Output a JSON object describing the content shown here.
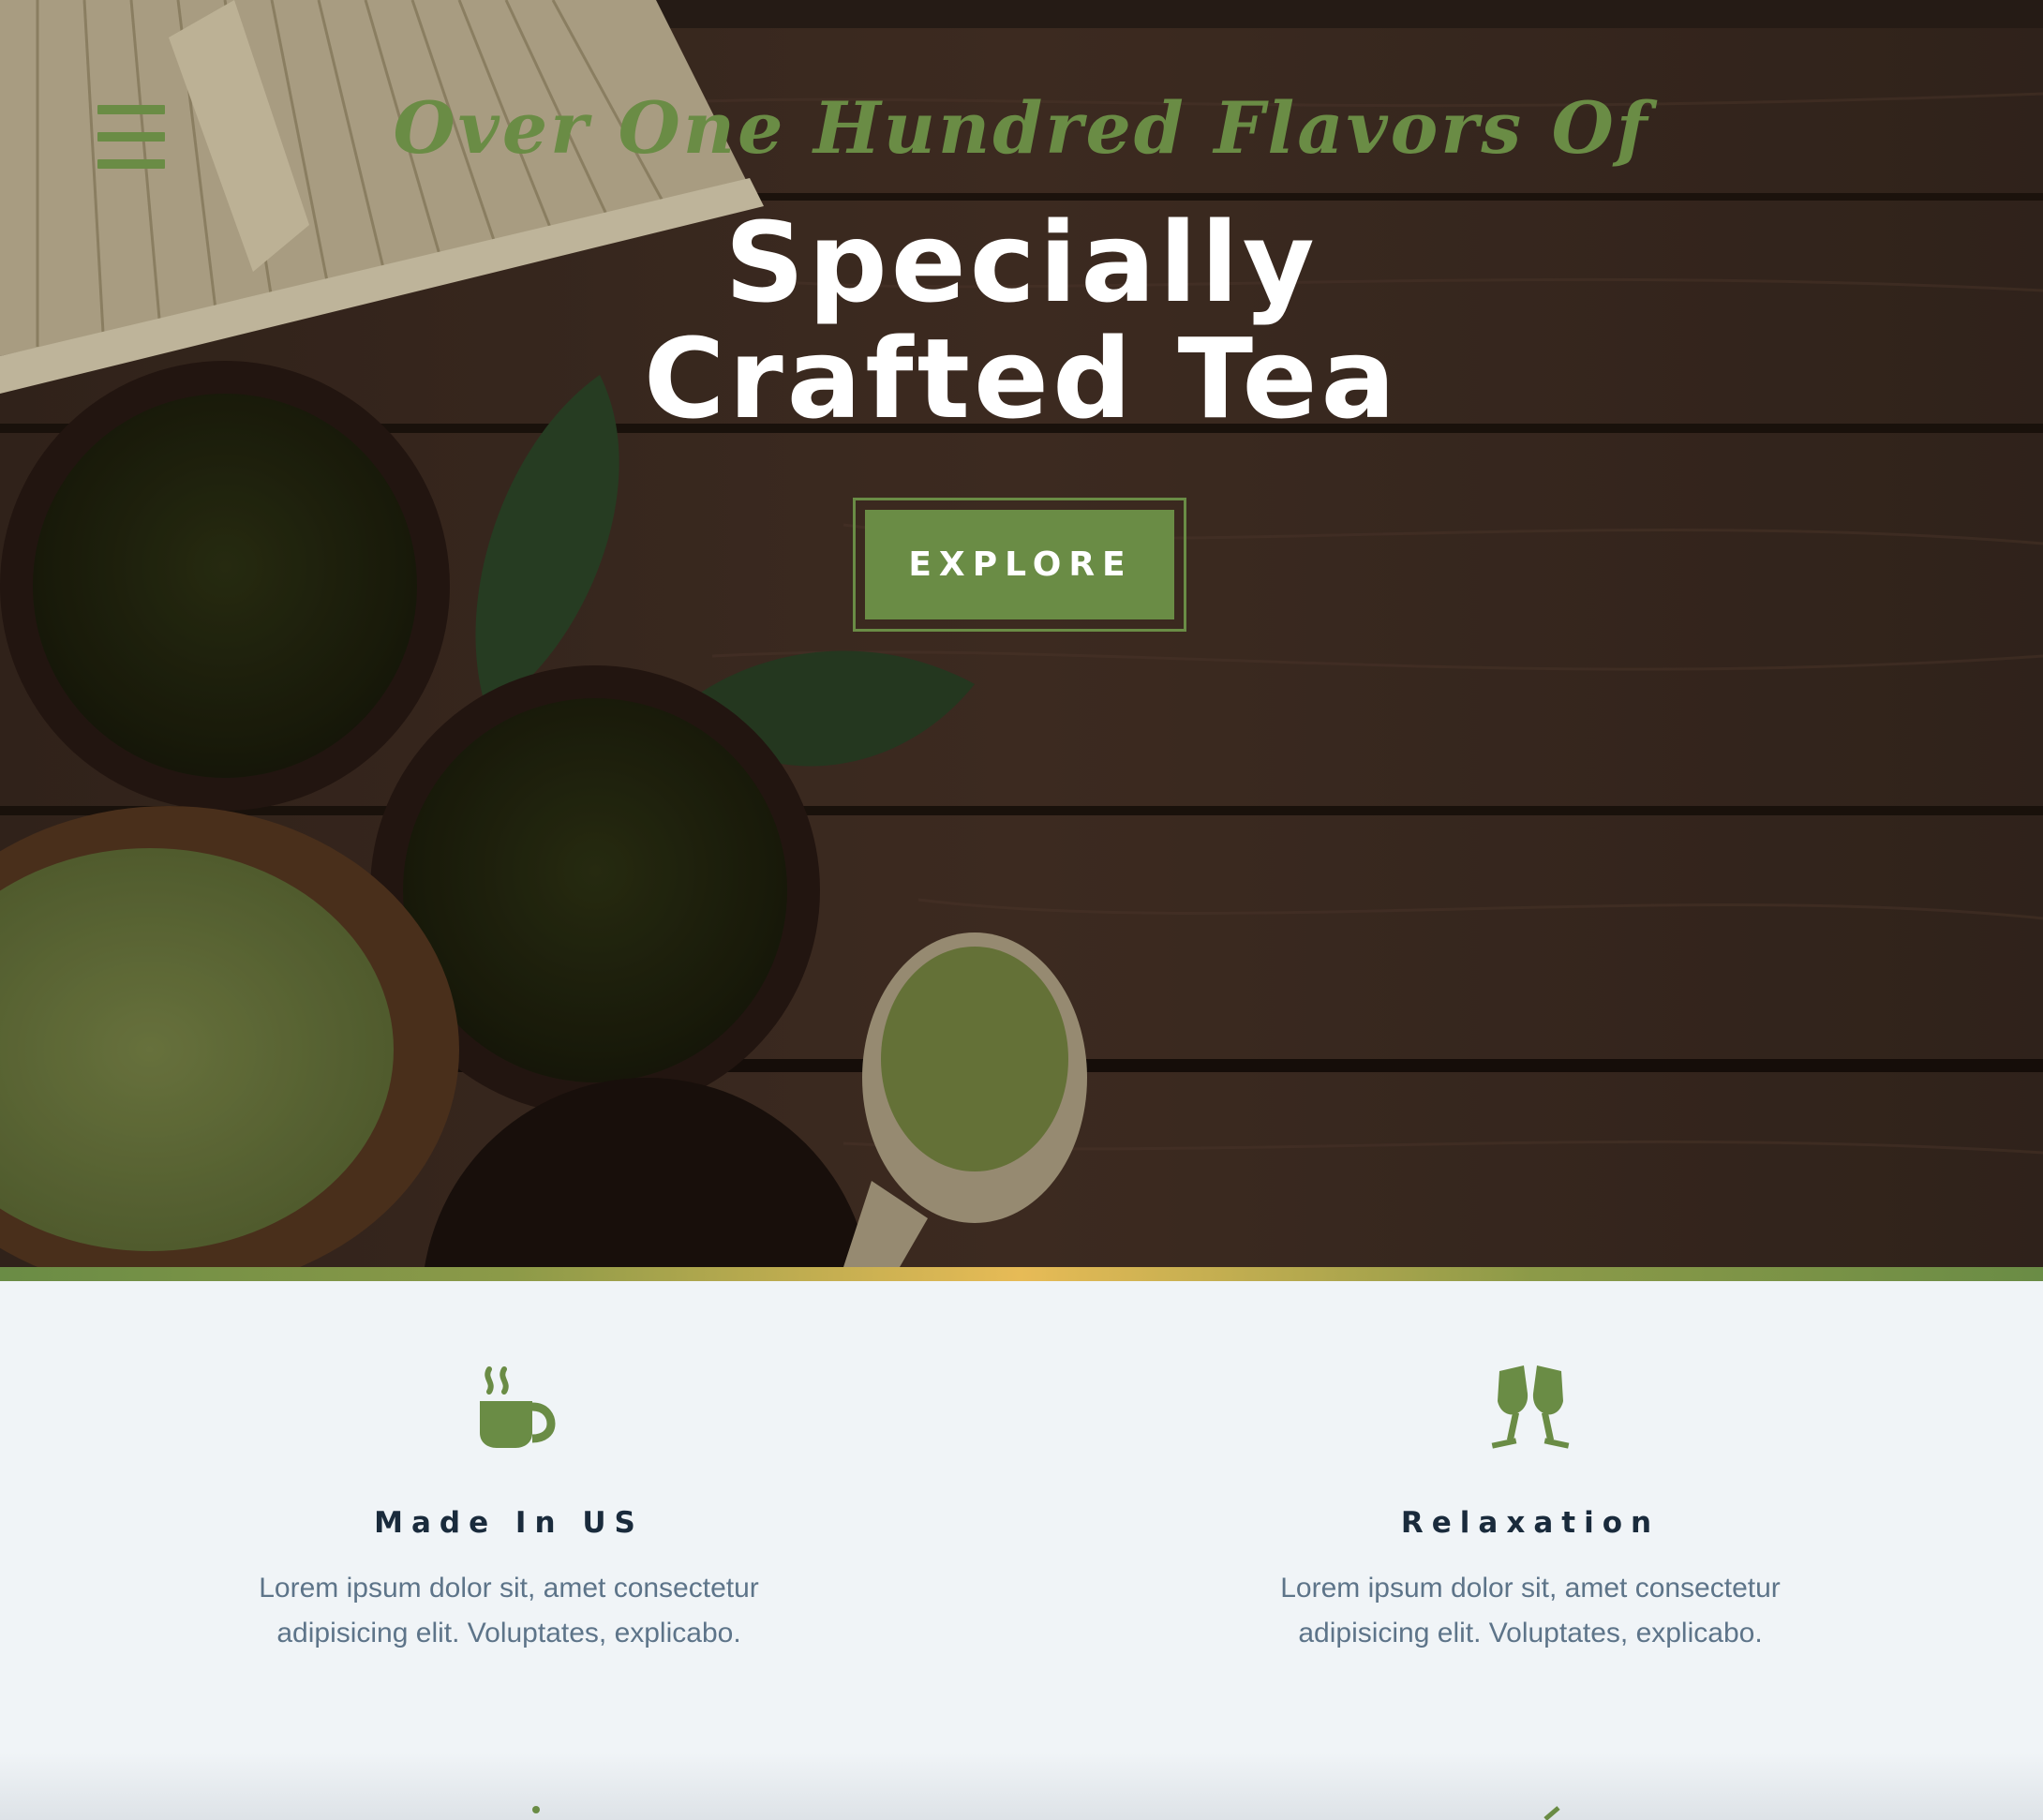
{
  "header": {
    "menu_icon": "hamburger-menu-icon",
    "eyebrow": "Over One Hundred Flavors Of",
    "title_line1": "Specially",
    "title_line2": "Crafted Tea",
    "cta_label": "EXPLORE"
  },
  "colors": {
    "accent_green": "#6a8c45",
    "gold": "#e7bb56",
    "heading_dark": "#1a2b3c",
    "body_text": "#5d7489",
    "section_bg": "#f0f4f7"
  },
  "features": [
    {
      "icon": "coffee-cup-icon",
      "title": "Made In US",
      "text": "Lorem ipsum dolor sit, amet consectetur adipisicing elit. Voluptates, explicabo."
    },
    {
      "icon": "glass-cheers-icon",
      "title": "Relaxation",
      "text": "Lorem ipsum dolor sit, amet consectetur adipisicing elit. Voluptates, explicabo."
    }
  ]
}
